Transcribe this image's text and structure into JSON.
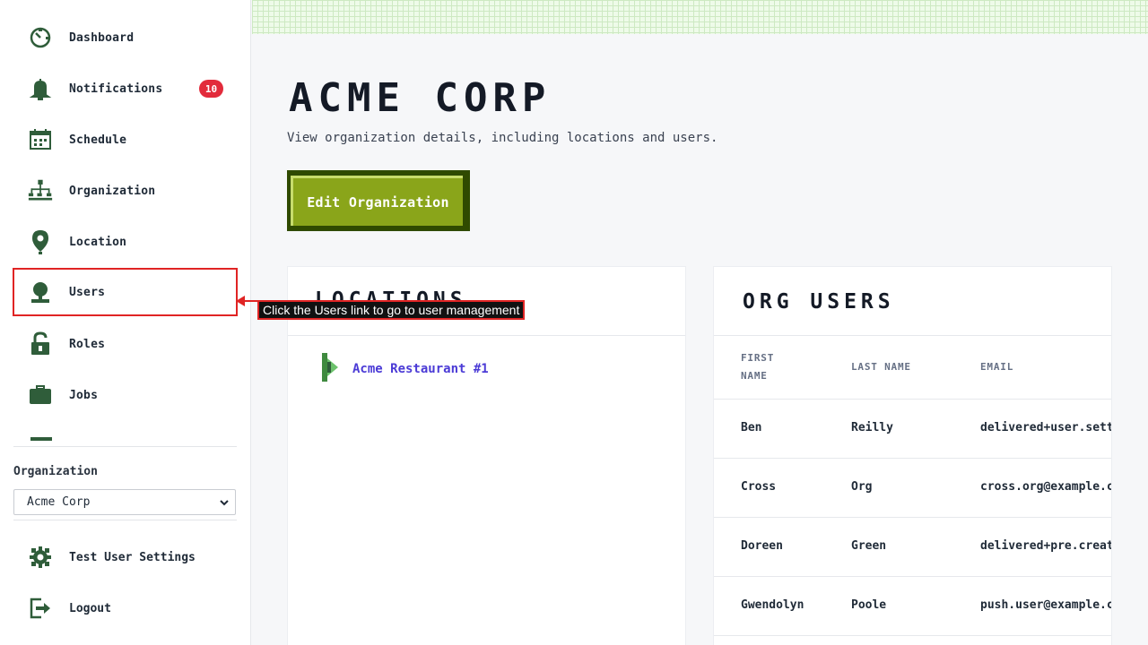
{
  "sidebar": {
    "items": [
      {
        "label": "Dashboard",
        "icon": "dashboard-icon"
      },
      {
        "label": "Notifications",
        "icon": "bell-icon",
        "badge": "10"
      },
      {
        "label": "Schedule",
        "icon": "calendar-icon"
      },
      {
        "label": "Organization",
        "icon": "org-chart-icon"
      },
      {
        "label": "Location",
        "icon": "map-pin-icon"
      },
      {
        "label": "Users",
        "icon": "user-icon"
      },
      {
        "label": "Roles",
        "icon": "lock-icon"
      },
      {
        "label": "Jobs",
        "icon": "briefcase-icon"
      }
    ],
    "organization_label": "Organization",
    "organization_value": "Acme Corp",
    "bottom_items": [
      {
        "label": "Test User Settings",
        "icon": "gear-icon"
      },
      {
        "label": "Logout",
        "icon": "logout-icon"
      }
    ]
  },
  "colors": {
    "icon_green": "#2f5d3a",
    "badge_red": "#e22b3b",
    "button_green": "#8aa51a",
    "link_purple": "#4b3bd6",
    "annotation_red": "#e02424"
  },
  "main": {
    "title": "ACME CORP",
    "subtitle": "View organization details, including locations and users.",
    "edit_button": "Edit Organization",
    "locations": {
      "title": "LOCATIONS",
      "items": [
        "Acme Restaurant #1"
      ]
    },
    "org_users": {
      "title": "ORG USERS",
      "headers": {
        "first": "FIRST NAME",
        "last": "LAST NAME",
        "email": "EMAIL"
      },
      "rows": [
        {
          "first": "Ben",
          "last": "Reilly",
          "email": "delivered+user.settin"
        },
        {
          "first": "Cross",
          "last": "Org",
          "email": "cross.org@example.com"
        },
        {
          "first": "Doreen",
          "last": "Green",
          "email": "delivered+pre.created"
        },
        {
          "first": "Gwendolyn",
          "last": "Poole",
          "email": "push.user@example.com"
        }
      ]
    }
  },
  "annotation": {
    "tooltip": "Click the Users link to go to user management"
  }
}
